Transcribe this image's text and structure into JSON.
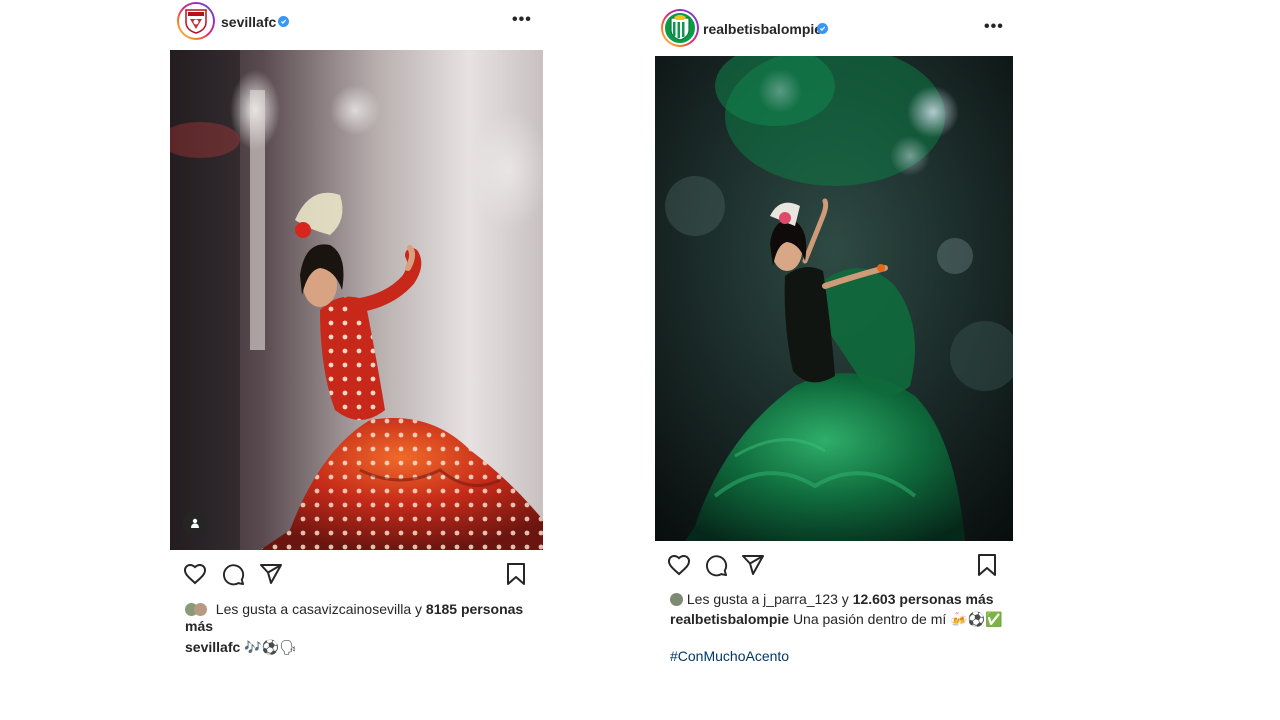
{
  "posts": [
    {
      "username": "sevillafc",
      "likes": {
        "prefix": "Les gusta a",
        "user": "casavizcainosevilla",
        "connector": "y",
        "count_text": "8185 personas más"
      },
      "caption": {
        "username": "sevillafc",
        "text": "🎶⚽️🗣"
      },
      "icons": [
        "heart-icon",
        "comment-icon",
        "share-icon",
        "bookmark-icon",
        "more-icon",
        "tag-user-icon"
      ],
      "colors": {
        "accent": "#d7261e",
        "dress": "#c8281a"
      }
    },
    {
      "username": "realbetisbalompie",
      "likes": {
        "prefix": "Les gusta a",
        "user": "j_parra_123",
        "connector": "y",
        "count_text": "12.603 personas más"
      },
      "caption": {
        "username": "realbetisbalompie",
        "text": "Una pasión dentro de mí 🍻⚽️✅"
      },
      "hashtag": "#ConMuchoAcento",
      "icons": [
        "heart-icon",
        "comment-icon",
        "share-icon",
        "bookmark-icon",
        "more-icon"
      ],
      "colors": {
        "accent": "#0b9a4a",
        "dress": "#0f5a35"
      }
    }
  ]
}
